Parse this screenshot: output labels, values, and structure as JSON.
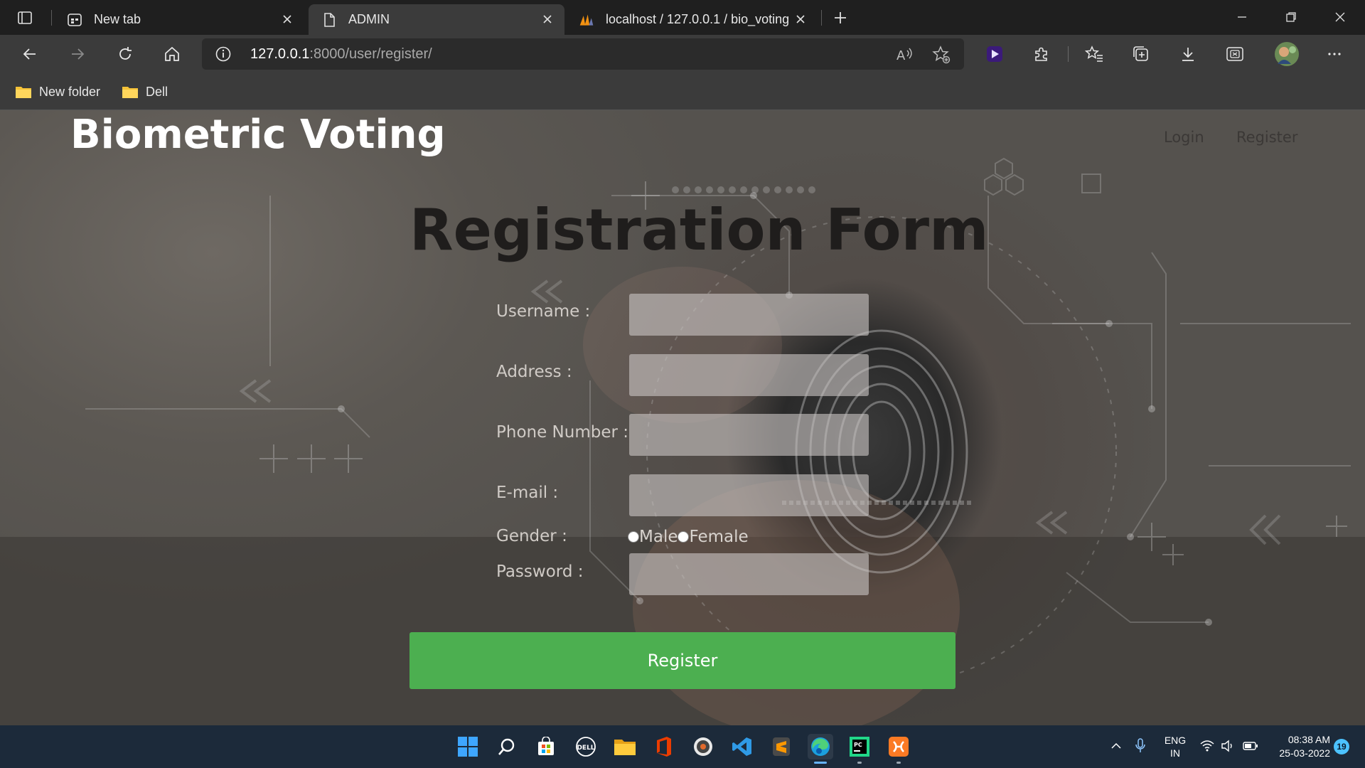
{
  "browser": {
    "tabs": [
      {
        "title": "New tab",
        "icon": "newtab-page-icon",
        "active": false
      },
      {
        "title": "ADMIN",
        "icon": "document-icon",
        "active": true
      },
      {
        "title": "localhost / 127.0.0.1 / bio_voting",
        "icon": "phpmyadmin-icon",
        "active": false
      }
    ],
    "url_host": "127.0.0.1",
    "url_rest": ":8000/user/register/",
    "favorites": [
      {
        "label": "New folder",
        "icon": "folder-icon"
      },
      {
        "label": "Dell",
        "icon": "folder-icon"
      }
    ]
  },
  "page": {
    "brand": "Biometric Voting",
    "nav": {
      "login": "Login",
      "register": "Register"
    },
    "title": "Registration Form",
    "fields": {
      "username_label": "Username :",
      "address_label": "Address :",
      "phone_label": "Phone Number :",
      "email_label": "E-mail :",
      "gender_label": "Gender :",
      "password_label": "Password :",
      "gender_male": "Male",
      "gender_female": "Female"
    },
    "register_button": "Register",
    "accent_color": "#4caf50"
  },
  "taskbar": {
    "language": "ENG",
    "region": "IN",
    "time": "08:38 AM",
    "date": "25-03-2022",
    "notifications": "19"
  }
}
